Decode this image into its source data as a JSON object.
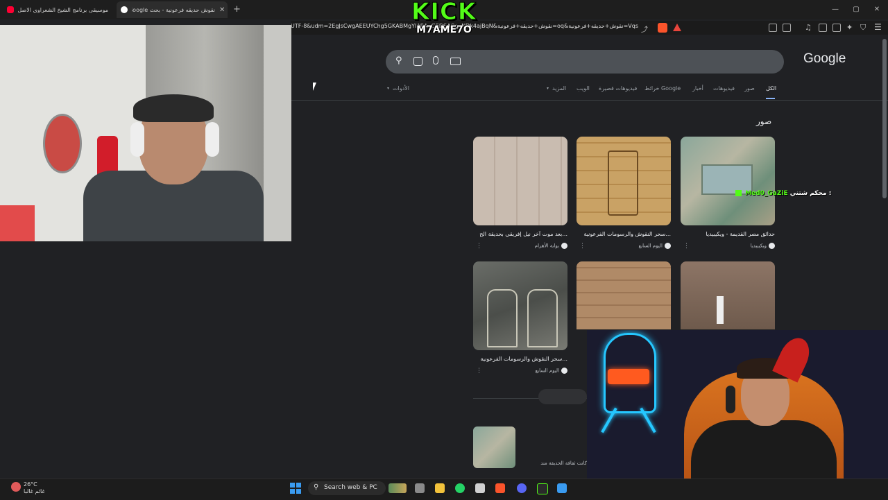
{
  "browser": {
    "tabs": [
      {
        "title": "موسيقى برنامج الشيخ الشعراوي الاصل",
        "active": false
      },
      {
        "title": "نقوش حديقه فرعونية - بحث Google",
        "active": true
      }
    ],
    "new_tab_label": "+",
    "url": "Vqs=نقوش+حديقه+فرعونية&oq=نقوش+حديقه+فرعونية&gs_lcrp=EgZjaHJvbWUyBggAEEUYOTIKCAEQABiABBiiBDIKCAIQABiABBiiBNIBCTE0MTQ2ajBqN6gCALACAA&sourceid=chrome&ie=UTF-8&udm=2EgJsCwgAEEUYChg5GKABMgYIARAuGEDSAQgzNDk4ajBqN"
  },
  "overlay": {
    "kick_word": "KICK",
    "channel": "M7AME7O",
    "chat": {
      "prefix": "محكم شتني :",
      "user": "Med0_GaZiE"
    }
  },
  "google": {
    "logo": "Google",
    "search_value": "",
    "nav_tabs": [
      "الكل",
      "صور",
      "فيديوهات",
      "أخبار",
      "خرائط Google",
      "فيديوهات قصيرة",
      "الويب",
      "المزيد",
      "الأدوات"
    ],
    "images_heading": "صور",
    "results": [
      {
        "caption": "حدائق مصر القديمة - ويكيبيديا",
        "source": "ويكيبيديا"
      },
      {
        "caption": "سحر النقوش والرسومات الفرعونية...",
        "source": "اليوم السابع"
      },
      {
        "caption": "بعد موت آخر نيل إفريقي بحديقة الح...",
        "source": "بوابة الأهرام"
      },
      {
        "caption": "",
        "source": ""
      },
      {
        "caption": "...",
        "source": ""
      },
      {
        "caption": "سحر النقوش والرسومات الفرعونية...",
        "source": "اليوم السابع"
      }
    ],
    "partial_caption": "كانت ثقافة الحديقة مند"
  },
  "taskbar": {
    "temperature": "26°C",
    "weather": "غائم غالبا",
    "search_label": "Search web & PC"
  },
  "colors": {
    "kick_green": "#53fc18",
    "link_blue": "#8ab4f8"
  }
}
